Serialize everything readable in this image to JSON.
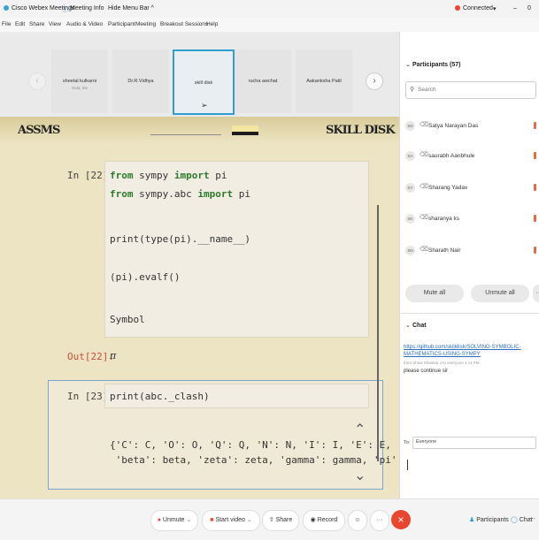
{
  "titlebar": {
    "app_name": "Cisco Webex Meetings",
    "meeting_info": "Meeting Info",
    "hide_menu": "Hide Menu Bar ^",
    "status": "Connected",
    "minimize": "–",
    "close": "0"
  },
  "menu": [
    "File",
    "Edit",
    "Share",
    "View",
    "Audio & Video",
    "Participant",
    "Meeting",
    "Breakout Sessions",
    "Help"
  ],
  "strip": {
    "tiles": [
      {
        "name": "sheetal kulkarni",
        "sub": "Host, me"
      },
      {
        "name": "Dr.R.Vidhya",
        "sub": ""
      },
      {
        "name": "skill disk",
        "sub": ""
      },
      {
        "name": "rucha awchat",
        "sub": ""
      },
      {
        "name": "Aakanksha Patil",
        "sub": ""
      }
    ],
    "next": "›"
  },
  "share": {
    "logo_left": "ASSMS",
    "logo_right": "SKILL DISK",
    "cell1": {
      "prompt": "In [22]:",
      "lines": [
        {
          "kw1": "from",
          "t1": " sympy ",
          "kw2": "import",
          "t2": " pi"
        },
        {
          "kw1": "from",
          "t1": " sympy.abc ",
          "kw2": "import",
          "t2": " pi"
        }
      ],
      "line3": "print(type(pi).__name__)",
      "line4": "(pi).evalf()",
      "output_text": "Symbol",
      "out_prompt": "Out[22]:",
      "out_value": "π"
    },
    "cell2": {
      "prompt": "In [23]:",
      "code": "print(abc._clash)",
      "out1": "{'C': C, 'O': O, 'Q': Q, 'N': N, 'I': I, 'E': E, 'S': S,",
      "out2": " 'beta': beta, 'zeta': zeta, 'gamma': gamma, 'pi': pi}"
    }
  },
  "participants": {
    "title": "Participants (57)",
    "search_placeholder": "Search",
    "list": [
      {
        "initials": "SD",
        "name": "Satya Narayan Das"
      },
      {
        "initials": "SA",
        "name": "saurabh Aanbhule"
      },
      {
        "initials": "SY",
        "name": "Sharang Yadav"
      },
      {
        "initials": "SK",
        "name": "sharanya ks"
      },
      {
        "initials": "SN",
        "name": "Sharath Nair"
      }
    ],
    "mute_all": "Mute all",
    "unmute_all": "Unmute all",
    "more": "···"
  },
  "chat": {
    "title": "Chat",
    "link_line1": "https://github.com/skilldisk/SOLVING-SYMBOLIC-",
    "link_line2": "MATHEMATICS-USING-SYMPY",
    "meta": "from Shiva Shankar J to everyone   1:11 PM",
    "message": "please continue sir",
    "to_label": "To:",
    "to_value": "Everyone"
  },
  "bottombar": {
    "unmute": "Unmute",
    "start_video": "Start video",
    "share": "Share",
    "record": "Record",
    "more": "···",
    "leave": "×",
    "participants": "Participants",
    "chat": "Chat"
  },
  "colors": {
    "accent": "#2f9fd0",
    "leave": "#e8462f",
    "keyword": "#2d7a2d",
    "out_prompt": "#c8503a",
    "link": "#2a6ebb",
    "connected": "#e8462f"
  }
}
